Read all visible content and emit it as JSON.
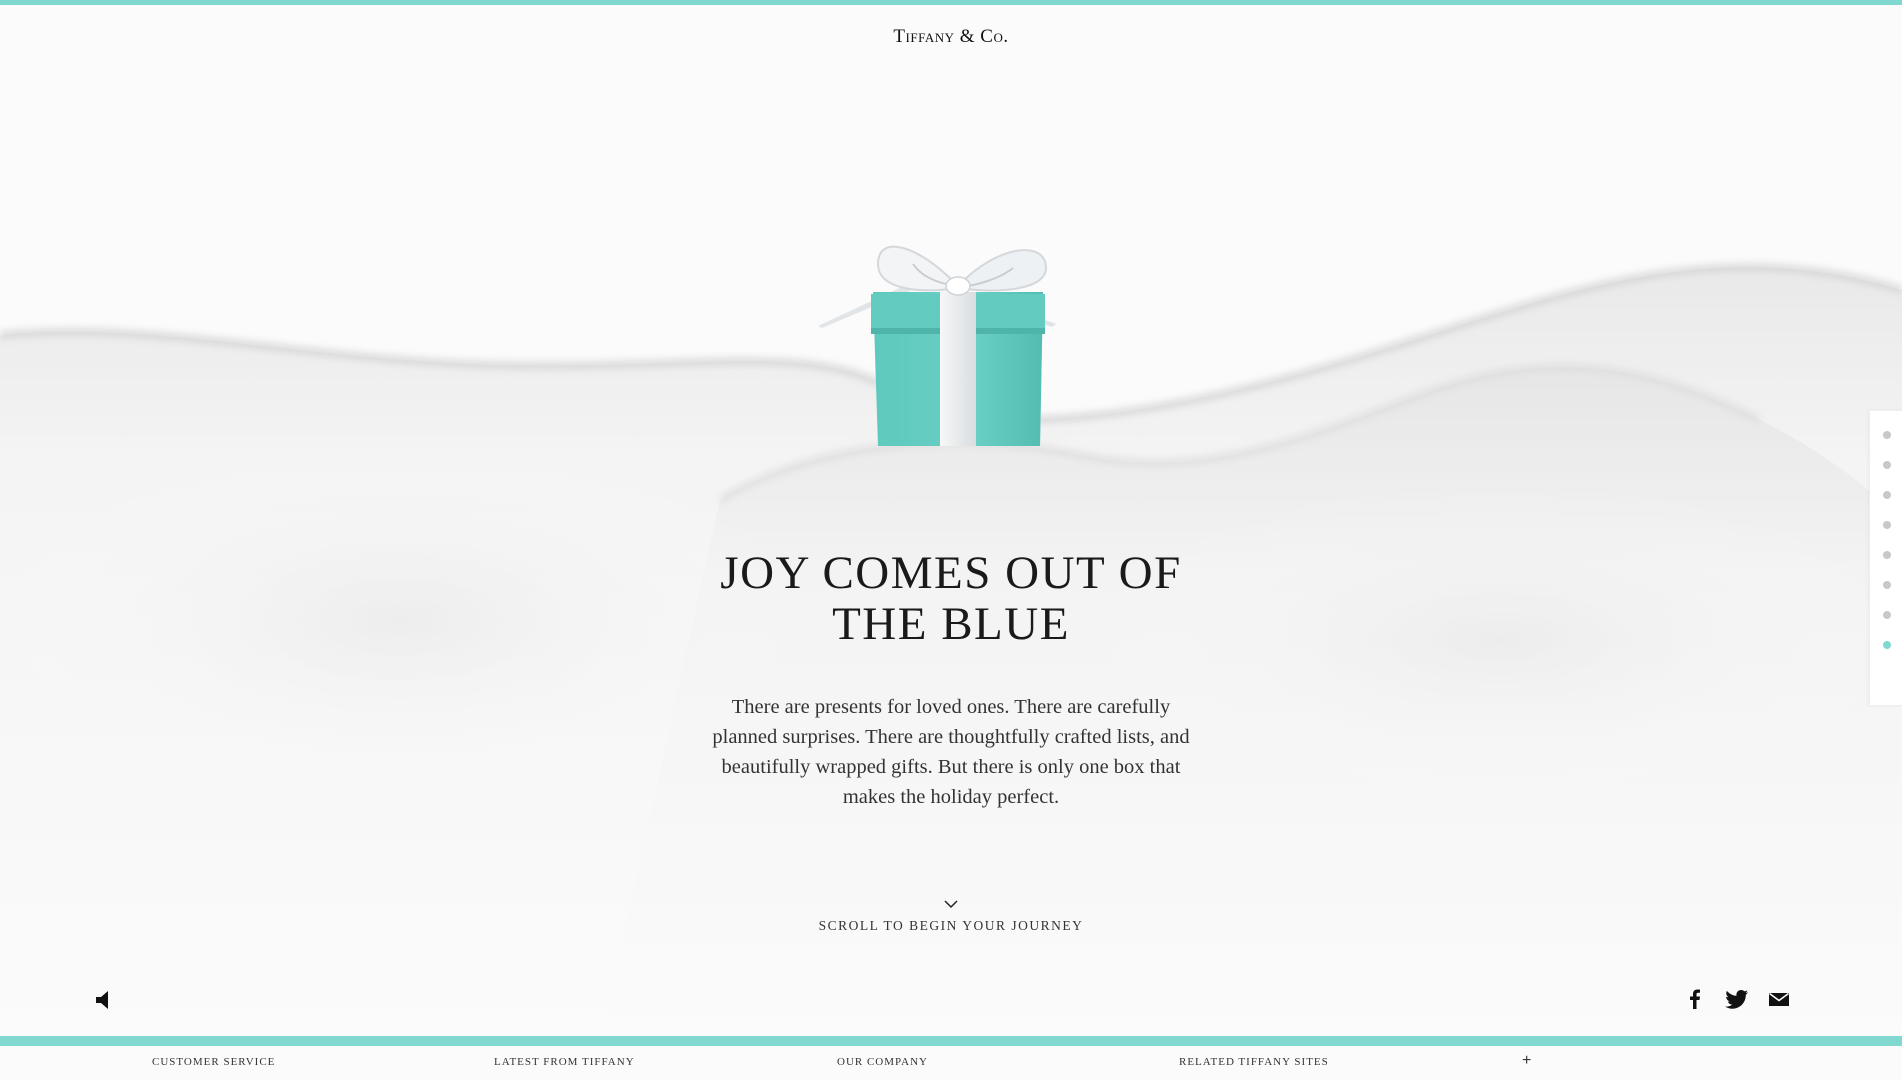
{
  "brand": {
    "logo_text": "Tiffany & Co.",
    "accent_color": "#81d8d0"
  },
  "hero": {
    "headline_line1": "JOY COMES OUT OF",
    "headline_line2": "THE BLUE",
    "body": "There are presents for loved ones. There are carefully planned surprises. There are thoughtfully crafted lists, and beautifully wrapped gifts. But there is only one box that makes the holiday perfect.",
    "scroll_label": "SCROLL TO BEGIN YOUR JOURNEY",
    "scroll_icon": "chevron-down-icon"
  },
  "controls": {
    "sound_icon": "speaker-icon",
    "social_icons": [
      "facebook-icon",
      "twitter-icon",
      "email-icon"
    ]
  },
  "section_nav": {
    "total": 8,
    "active_index": 7
  },
  "footer": {
    "links": [
      "CUSTOMER SERVICE",
      "LATEST FROM TIFFANY",
      "OUR COMPANY",
      "RELATED TIFFANY SITES"
    ],
    "expand_label": "+"
  }
}
